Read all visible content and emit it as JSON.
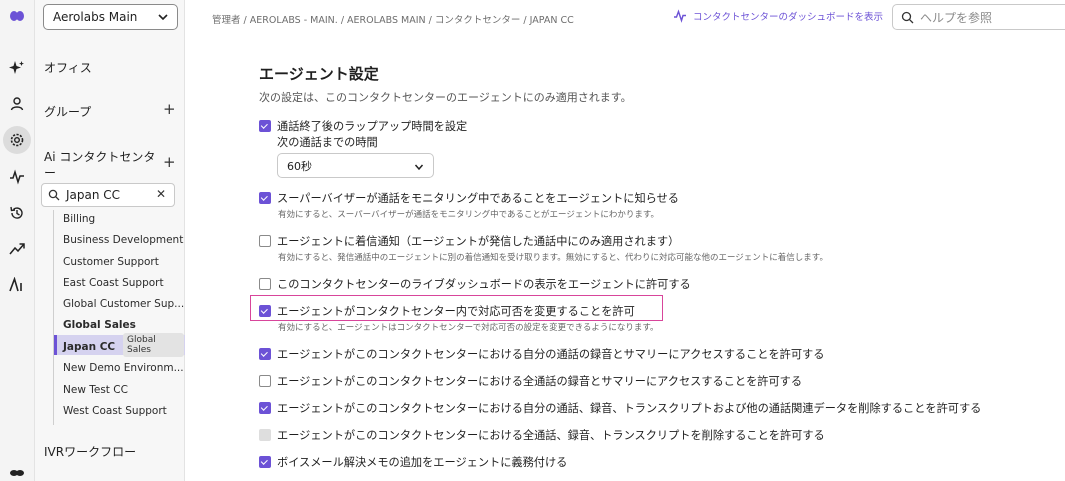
{
  "workspace": {
    "name": "Aerolabs Main"
  },
  "rail": {
    "icons": [
      "logo-icon",
      "sparkle-icon",
      "user-icon",
      "settings-icon",
      "activity-icon",
      "history-icon",
      "trending-icon",
      "ai-icon",
      "brand-icon"
    ]
  },
  "nav": {
    "office": "オフィス",
    "group": "グループ",
    "ai_cc": "Ai コンタクトセンタ",
    "ai_cc_2": "ー",
    "search_value": "Japan CC",
    "items": [
      "Billing",
      "Business Development",
      "Customer Support",
      "East Coast Support",
      "Global Customer Sup...",
      "Global Sales",
      "Japan CC",
      "New Demo Environm...",
      "New Test CC",
      "West Coast Support"
    ],
    "tooltip": "Global Sales",
    "ivr": "IVRワークフロー"
  },
  "topbar": {
    "breadcrumb": "管理者 / AEROLABS - MAIN. / AEROLABS MAIN / コンタクトセンター / JAPAN CC",
    "dashboard_link": "コンタクトセンターのダッシュボードを表示",
    "help_placeholder": "ヘルプを参照"
  },
  "main": {
    "title": "エージェント設定",
    "subtitle": "次の設定は、このコンタクトセンターのエージェントにのみ適用されます。",
    "wrap_label": "通話終了後のラップアップ時間を設定",
    "next_call_label": "次の通話までの時間",
    "next_call_value": "60秒",
    "settings": [
      {
        "label": "スーパーバイザーが通話をモニタリング中であることをエージェントに知らせる",
        "desc": "有効にすると、スーパーバイザーが通話をモニタリング中であることがエージェントにわかります。"
      },
      {
        "label": "エージェントに着信通知（エージェントが発信した通話中にのみ適用されます）",
        "desc": "有効にすると、発信通話中のエージェントに別の着信通知を受け取ります。無効にすると、代わりに対応可能な他のエージェントに着信します。"
      },
      {
        "label": "このコンタクトセンターのライブダッシュボードの表示をエージェントに許可する",
        "desc": ""
      },
      {
        "label": "エージェントがコンタクトセンター内で対応可否を変更することを許可",
        "desc": "有効にすると、エージェントはコンタクトセンターで対応可否の設定を変更できるようになります。"
      },
      {
        "label": "エージェントがこのコンタクトセンターにおける自分の通話の録音とサマリーにアクセスすることを許可する",
        "desc": ""
      },
      {
        "label": "エージェントがこのコンタクトセンターにおける全通話の録音とサマリーにアクセスすることを許可する",
        "desc": ""
      },
      {
        "label": "エージェントがこのコンタクトセンターにおける自分の通話、録音、トランスクリプトおよび他の通話関連データを削除することを許可する",
        "desc": ""
      },
      {
        "label": "エージェントがこのコンタクトセンターにおける全通話、録音、トランスクリプトを削除することを許可する",
        "desc": ""
      },
      {
        "label": "ボイスメール解決メモの追加をエージェントに義務付ける",
        "desc": ""
      }
    ]
  },
  "colors": {
    "accent": "#6c52d6",
    "highlight": "#d8459b",
    "selected_bg": "#d5d2ef"
  }
}
